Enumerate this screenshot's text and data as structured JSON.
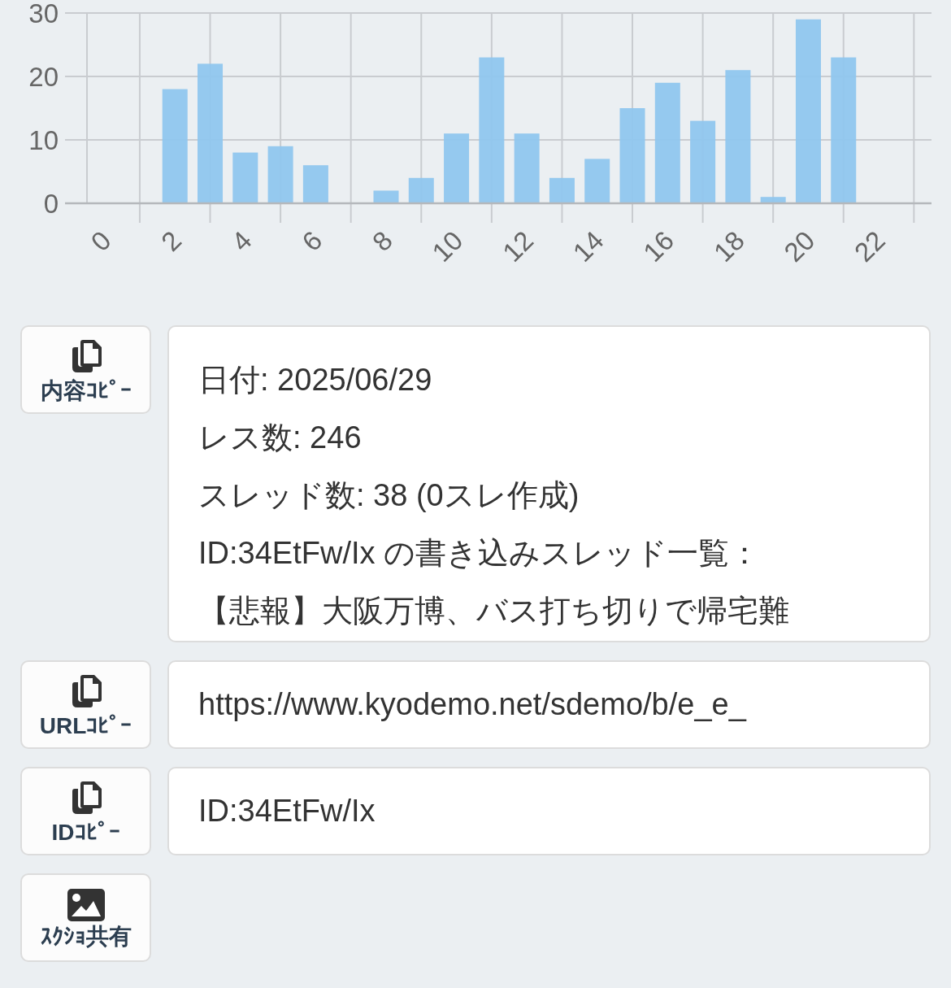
{
  "chart_data": {
    "type": "bar",
    "x": [
      0,
      1,
      2,
      3,
      4,
      5,
      6,
      7,
      8,
      9,
      10,
      11,
      12,
      13,
      14,
      15,
      16,
      17,
      18,
      19,
      20,
      21,
      22,
      23
    ],
    "grid": true,
    "xlim": [
      -0.5,
      23.5
    ],
    "series": [
      {
        "color": "#90c6ee",
        "values": [
          0,
          0,
          18,
          22,
          8,
          9,
          6,
          0,
          2,
          4,
          11,
          23,
          11,
          4,
          7,
          15,
          19,
          13,
          21,
          1,
          29,
          23,
          0,
          0
        ]
      }
    ],
    "ylim": [
      0,
      30
    ],
    "yticks": [
      0,
      10,
      20,
      30
    ],
    "xticks": [
      0,
      2,
      4,
      6,
      8,
      10,
      12,
      14,
      16,
      18,
      20,
      22
    ]
  },
  "rows": [
    {
      "button": {
        "kind": "copy",
        "label": "内容ｺﾋﾟｰ"
      },
      "field": {
        "kind": "textarea",
        "lines": [
          "日付: 2025/06/29",
          "レス数: 246",
          "スレッド数: 38 (0スレ作成)",
          "ID:34EtFw/Ix の書き込みスレッド一覧：",
          "【悲報】大阪万博、バス打ち切りで帰宅難"
        ]
      }
    },
    {
      "button": {
        "kind": "copy",
        "label": "URLｺﾋﾟｰ"
      },
      "field": {
        "kind": "input",
        "value": "https://www.kyodemo.net/sdemo/b/e_e_"
      }
    },
    {
      "button": {
        "kind": "copy",
        "label": "IDｺﾋﾟｰ"
      },
      "field": {
        "kind": "input",
        "value": "ID:34EtFw/Ix"
      }
    },
    {
      "button": {
        "kind": "image",
        "label": "ｽｸｼｮ共有"
      }
    }
  ]
}
